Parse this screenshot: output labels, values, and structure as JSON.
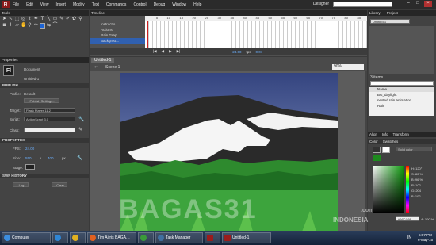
{
  "menubar": {
    "logo": "Fl",
    "items": [
      "File",
      "Edit",
      "View",
      "Insert",
      "Modify",
      "Text",
      "Commands",
      "Control",
      "Debug",
      "Window",
      "Help"
    ],
    "workspace": "Designer"
  },
  "tools": {
    "title": "Tools"
  },
  "timeline": {
    "title": "Timeline",
    "layers": [
      "Instructio…",
      "Actions",
      "Rain Grap…",
      "Backgrou…"
    ],
    "frame_numbers": [
      "5",
      "10",
      "15",
      "20",
      "25",
      "30",
      "35",
      "40",
      "45",
      "50",
      "55",
      "60",
      "65",
      "70",
      "75",
      "80",
      "85"
    ],
    "fps": "24.00",
    "fps_unit": "fps",
    "time": "0.0s"
  },
  "document_tab": "Untitled-1",
  "scene": "Scene 1",
  "zoom": "90%",
  "properties": {
    "tab": "Properties",
    "doc_type": "Document",
    "doc_name": "Untitled-1",
    "publish": "PUBLISH",
    "profile_label": "Profile:",
    "profile_value": "Default",
    "publish_settings": "Publish Settings...",
    "target_label": "Target:",
    "target_value": "Flash Player 11.2",
    "script_label": "Script:",
    "script_value": "ActionScript 3.0",
    "class_label": "Class:",
    "section_properties": "PROPERTIES",
    "fps_label": "FPS:",
    "fps_value": "24.00",
    "size_label": "Size:",
    "width": "550",
    "x": "x",
    "height": "400",
    "px": "px",
    "stage_label": "Stage:",
    "swf_history": "SWF HISTORY",
    "log": "Log",
    "clear": "Clear"
  },
  "library": {
    "tabs": [
      "Library",
      "Project"
    ],
    "doc": "Untitled-1",
    "count": "3 items",
    "search_placeholder": "",
    "name_col": "Name",
    "items": [
      "BG_daylight",
      "nested rain animation",
      "Rain"
    ]
  },
  "align_tabs": [
    "Align",
    "Info",
    "Transform"
  ],
  "color_panel": {
    "tabs": [
      "Color",
      "Swatches"
    ],
    "mode": "Solid color",
    "h": "H: 120°",
    "s": "S: 80 %",
    "b": "B: 96 %",
    "r": "R: 102",
    "g": "G: 204",
    "bl": "B: 102",
    "hex": "#66CC66",
    "alpha": "A: 100 %"
  },
  "taskbar": {
    "items": [
      "Computer",
      "",
      "",
      "Tim Airris BAGA…",
      "",
      "Task Manager",
      "",
      "Untitled-1"
    ],
    "lang": "IN",
    "time": "5:07 PM",
    "date": "6-May-15"
  },
  "watermark": {
    "text": "BAGAS31",
    "sub": "INDONESIA",
    "domain": ".com"
  },
  "colors": {
    "sky_top": "#3a4a8a",
    "sky_bottom": "#8fa0cf",
    "mountain": "#2e2e2e",
    "grass": "#3aa33a"
  }
}
